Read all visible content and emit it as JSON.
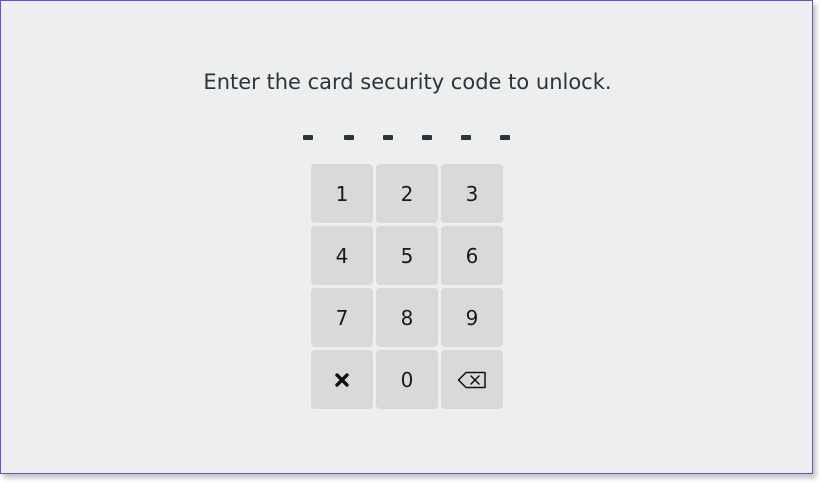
{
  "prompt": "Enter the card security code to unlock.",
  "pin": {
    "length": 6,
    "entered": ""
  },
  "keypad": {
    "keys": [
      {
        "label": "1"
      },
      {
        "label": "2"
      },
      {
        "label": "3"
      },
      {
        "label": "4"
      },
      {
        "label": "5"
      },
      {
        "label": "6"
      },
      {
        "label": "7"
      },
      {
        "label": "8"
      },
      {
        "label": "9"
      },
      {
        "icon": "cancel-icon"
      },
      {
        "label": "0"
      },
      {
        "icon": "backspace-icon"
      }
    ]
  },
  "colors": {
    "background": "#edeef0",
    "key": "#d8d9db",
    "text": "#2e3436",
    "window_border": "#6a4fc0"
  }
}
